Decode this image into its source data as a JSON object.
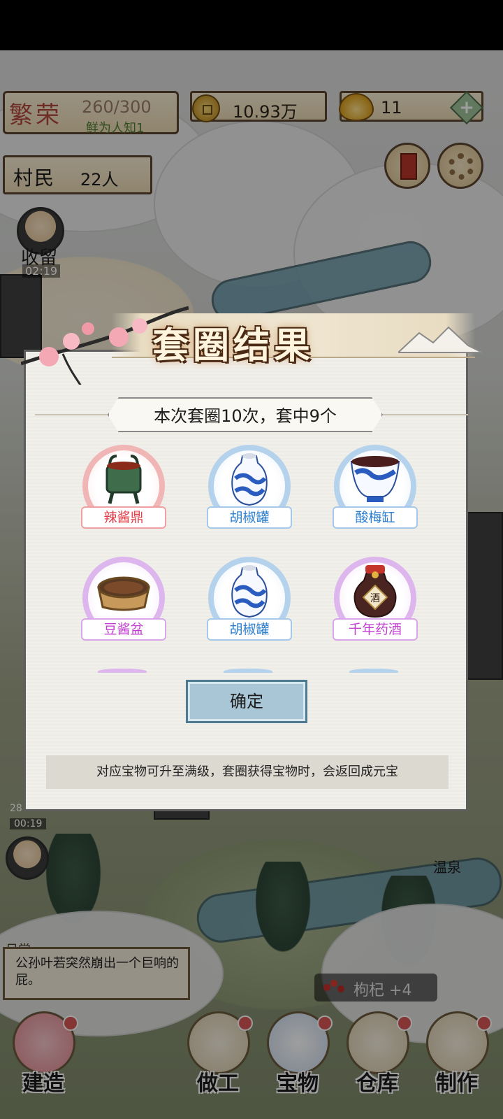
{
  "hud": {
    "prosperity_title": "繁荣",
    "prosperity_value": "260/300",
    "prosperity_tag": "鲜为人知1",
    "coins": "10.93万",
    "ingots": "11",
    "plus": "+",
    "villagers_label": "村民",
    "villagers_count": "22人"
  },
  "side": {
    "collect_label": "收留",
    "collect_timer": "02:19",
    "left_number": "28",
    "left_timer": "00:19",
    "hotspring": "温泉"
  },
  "modal": {
    "title": "套圈结果",
    "summary": "本次套圈10次，套中9个",
    "items": [
      {
        "name": "辣酱鼎",
        "rarity": "red",
        "icon": "bronze-ding-icon"
      },
      {
        "name": "胡椒罐",
        "rarity": "blue",
        "icon": "porcelain-jar-icon"
      },
      {
        "name": "酸梅缸",
        "rarity": "blue",
        "icon": "porcelain-bowl-icon"
      },
      {
        "name": "豆酱盆",
        "rarity": "purple",
        "icon": "wooden-basin-icon"
      },
      {
        "name": "胡椒罐",
        "rarity": "blue",
        "icon": "porcelain-jar-icon"
      },
      {
        "name": "千年药酒",
        "rarity": "purple",
        "icon": "wine-jar-icon"
      }
    ],
    "wine_mark": "酒",
    "confirm": "确定",
    "hint": "对应宝物可升至满级，套圈获得宝物时，会返回成元宝"
  },
  "log": {
    "tag": "日常",
    "text": "公孙叶若突然崩出一个巨响的屁。"
  },
  "toast": {
    "label": "枸杞",
    "amount": "+4"
  },
  "bottom_nav": [
    "建造",
    "做工",
    "宝物",
    "仓库",
    "制作"
  ],
  "colors": {
    "confirm_bg": "#a9c6d6",
    "rarity_red": "#e0404a",
    "rarity_blue": "#2f7fcf",
    "rarity_purple": "#c03fd0"
  }
}
